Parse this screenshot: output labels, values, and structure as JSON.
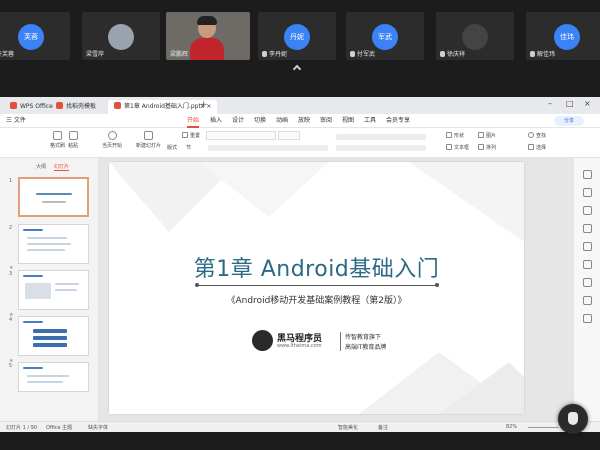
{
  "meeting": {
    "participants": [
      {
        "name": "许芙蓉",
        "avatar": "芙蓉"
      },
      {
        "name": "梁雪岸",
        "avatar": ""
      },
      {
        "name": "梁鹏辉",
        "avatar": ""
      },
      {
        "name": "李丹妮",
        "avatar": "丹妮"
      },
      {
        "name": "付军武",
        "avatar": "军武"
      },
      {
        "name": "徐庆祥",
        "avatar": ""
      },
      {
        "name": "解佳玮",
        "avatar": "佳玮"
      }
    ],
    "avatar_color": "#3b82f6"
  },
  "tabs": [
    {
      "label": "WPS Office"
    },
    {
      "label": "找稻壳模板"
    },
    {
      "label": "第1章 Android基础入门.pptx"
    }
  ],
  "menus": [
    "三 文件",
    "开始",
    "插入",
    "设计",
    "切换",
    "动画",
    "放映",
    "审阅",
    "视图",
    "工具",
    "会员专享"
  ],
  "active_menu": "开始",
  "share_label": "分享",
  "ribbon": {
    "format_painter": "格式刷",
    "paste": "粘贴",
    "play_from": "当页开始",
    "new_slide": "新建幻灯片",
    "layout": "版式",
    "section": "节",
    "reset": "重置",
    "textbox": "文本框",
    "arrange": "排列",
    "shape": "形状",
    "image": "图片",
    "find": "查找",
    "select": "选择"
  },
  "side_tabs": [
    "大纲",
    "幻灯片"
  ],
  "thumbnails": [
    "1",
    "2",
    "3",
    "4",
    "5"
  ],
  "slide": {
    "title": "第1章 Android基础入门",
    "subtitle": "《Android移动开发基础案例教程（第2版）》",
    "logo_name": "黑马程序员",
    "logo_url": "www.itheima.com",
    "slogan_1": "传智教育旗下",
    "slogan_2": "高端IT教育品牌"
  },
  "status": {
    "slide_count": "幻灯片 1 / 90",
    "theme": "Office 主题",
    "missing_font": "缺失字体",
    "smart_beautify": "智能美化",
    "notes": "备注",
    "zoom": "82%"
  },
  "colors": {
    "accent": "#e0523b",
    "title": "#2b6a86"
  }
}
